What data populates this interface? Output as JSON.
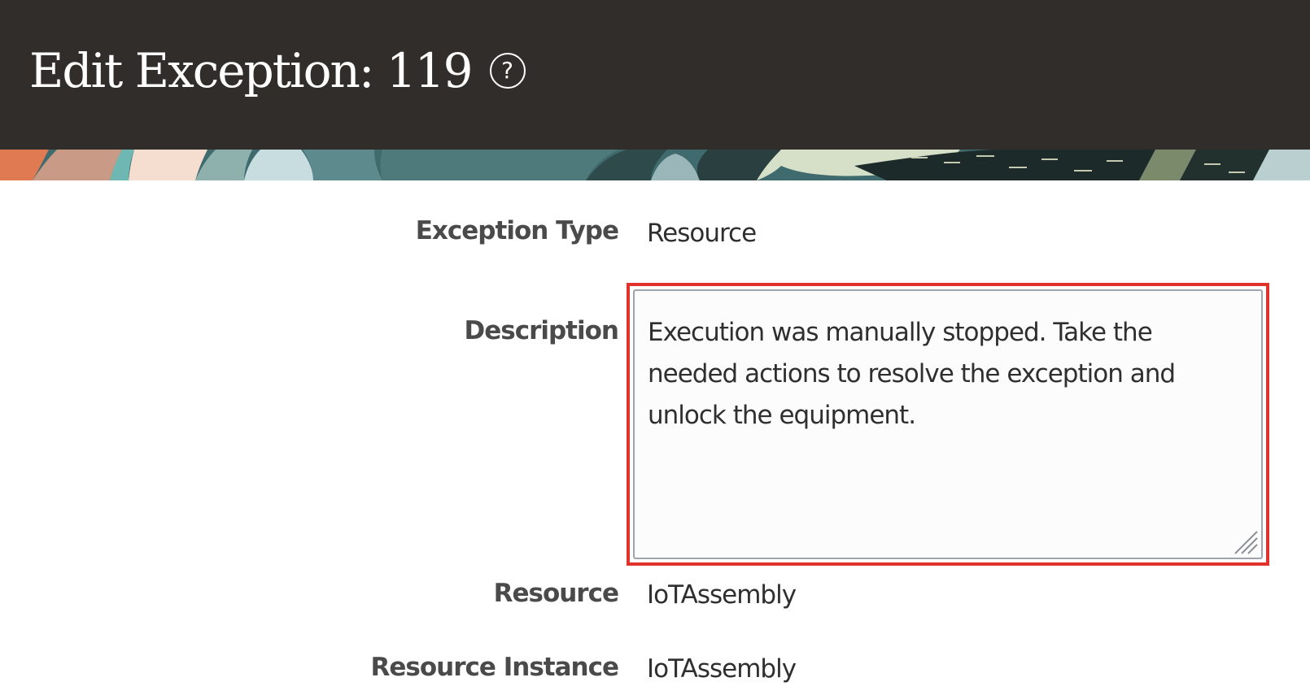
{
  "header": {
    "title": "Edit Exception: 119",
    "help_icon": "question-circle-icon",
    "help_symbol": "?"
  },
  "colors": {
    "header_bg": "#312d2a",
    "highlight_border": "#e0332c",
    "label_text": "#4a4a4a",
    "value_text": "#2f2f2f"
  },
  "form": {
    "exception_type": {
      "label": "Exception Type",
      "value": "Resource"
    },
    "description": {
      "label": "Description",
      "value": "Execution was manually stopped. Take the needed actions to resolve the exception and unlock the equipment."
    },
    "resource": {
      "label": "Resource",
      "value": "IoTAssembly"
    },
    "resource_instance": {
      "label": "Resource Instance",
      "value": "IoTAssembly"
    }
  }
}
